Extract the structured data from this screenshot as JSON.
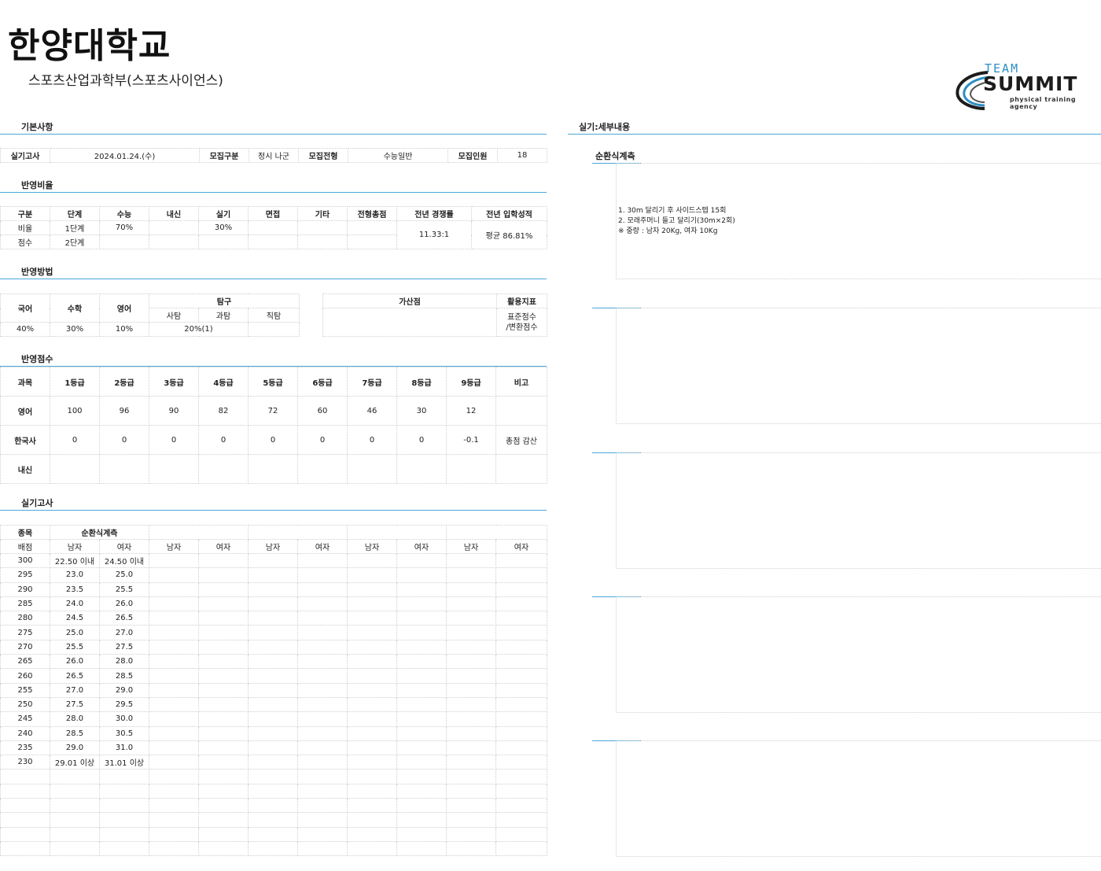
{
  "header": {
    "university": "한양대학교",
    "department": "스포츠산업과학부(스포츠사이언스)"
  },
  "logo": {
    "team": "TEAM",
    "summit": "SUMMIT",
    "sub": "physical training agency",
    "accent": "#2d8fc4"
  },
  "sections": {
    "basic": "기본사항",
    "ratio": "반영비율",
    "method": "반영방법",
    "score": "반영점수",
    "exam": "실기고사",
    "detail": "실기:세부내용",
    "circuit": "순환식계측"
  },
  "basic": {
    "exam_label": "실기고사",
    "exam_date": "2024.01.24.(수)",
    "group_label": "모집구분",
    "group_value": "정시 나군",
    "type_label": "모집전형",
    "type_value": "수능일반",
    "count_label": "모집인원",
    "count_value": "18"
  },
  "ratio": {
    "headers": [
      "구분",
      "단계",
      "수능",
      "내신",
      "실기",
      "면접",
      "기타",
      "전형총점",
      "전년 경쟁률",
      "전년 입학성적"
    ],
    "row1": [
      "비율",
      "1단계",
      "70%",
      "",
      "30%",
      "",
      "",
      ""
    ],
    "row2": [
      "점수",
      "2단계",
      "",
      "",
      "",
      "",
      "",
      ""
    ],
    "competition": "11.33:1",
    "admission": "평균 86.81%"
  },
  "method": {
    "korean": "국어",
    "math": "수학",
    "english": "영어",
    "inquiry": "탐구",
    "social": "사탐",
    "science": "과탐",
    "vocational": "직탐",
    "bonus": "가산점",
    "index": "활용지표",
    "index_value1": "표준점수",
    "index_value2": "/변환점수",
    "v_korean": "40%",
    "v_math": "30%",
    "v_english": "10%",
    "v_inquiry": "20%(1)"
  },
  "score": {
    "headers": [
      "과목",
      "1등급",
      "2등급",
      "3등급",
      "4등급",
      "5등급",
      "6등급",
      "7등급",
      "8등급",
      "9등급",
      "비고"
    ],
    "english": [
      "영어",
      "100",
      "96",
      "90",
      "82",
      "72",
      "60",
      "46",
      "30",
      "12",
      ""
    ],
    "history": [
      "한국사",
      "0",
      "0",
      "0",
      "0",
      "0",
      "0",
      "0",
      "0",
      "-0.1",
      "총점 감산"
    ],
    "school": [
      "내신",
      "",
      "",
      "",
      "",
      "",
      "",
      "",
      "",
      "",
      ""
    ]
  },
  "exam": {
    "item_label": "종목",
    "event": "순환식계측",
    "score_label": "배점",
    "male": "남자",
    "female": "여자",
    "rows": [
      [
        "300",
        "22.50 이내",
        "24.50 이내"
      ],
      [
        "295",
        "23.0",
        "25.0"
      ],
      [
        "290",
        "23.5",
        "25.5"
      ],
      [
        "285",
        "24.0",
        "26.0"
      ],
      [
        "280",
        "24.5",
        "26.5"
      ],
      [
        "275",
        "25.0",
        "27.0"
      ],
      [
        "270",
        "25.5",
        "27.5"
      ],
      [
        "265",
        "26.0",
        "28.0"
      ],
      [
        "260",
        "26.5",
        "28.5"
      ],
      [
        "255",
        "27.0",
        "29.0"
      ],
      [
        "250",
        "27.5",
        "29.5"
      ],
      [
        "245",
        "28.0",
        "30.0"
      ],
      [
        "240",
        "28.5",
        "30.5"
      ],
      [
        "235",
        "29.0",
        "31.0"
      ],
      [
        "230",
        "29.01 이상",
        "31.01 이상"
      ]
    ]
  },
  "detail": {
    "line1": "1. 30m 달리기 후 사이드스텝 15회",
    "line2": "2. 모래주머니 들고 달리기(30m×2회)",
    "line3": "※ 중량 : 남자 20Kg, 여자 10Kg"
  }
}
